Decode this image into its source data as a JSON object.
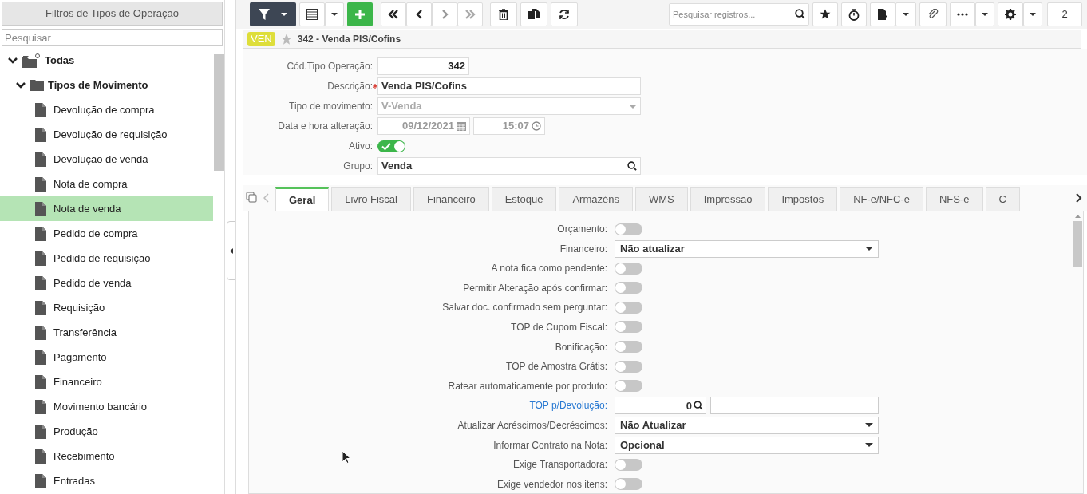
{
  "sidebar": {
    "title": "Filtros de Tipos de Operação",
    "search": {
      "placeholder": "Pesquisar"
    },
    "tree": [
      {
        "label": "Todas",
        "kind": "root",
        "expanded": true,
        "children": [
          {
            "label": "Tipos de Movimento",
            "kind": "folder",
            "expanded": true,
            "children": [
              {
                "label": "Devolução de compra",
                "selected": false
              },
              {
                "label": "Devolução de requisição",
                "selected": false
              },
              {
                "label": "Devolução de venda",
                "selected": false
              },
              {
                "label": "Nota de compra",
                "selected": false
              },
              {
                "label": "Nota de venda",
                "selected": true
              },
              {
                "label": "Pedido de compra",
                "selected": false
              },
              {
                "label": "Pedido de requisição",
                "selected": false
              },
              {
                "label": "Pedido de venda",
                "selected": false
              },
              {
                "label": "Requisição",
                "selected": false
              },
              {
                "label": "Transferência",
                "selected": false
              },
              {
                "label": "Pagamento",
                "selected": false
              },
              {
                "label": "Financeiro",
                "selected": false
              },
              {
                "label": "Movimento bancário",
                "selected": false
              },
              {
                "label": "Produção",
                "selected": false
              },
              {
                "label": "Recebimento",
                "selected": false
              },
              {
                "label": "Entradas",
                "selected": false
              }
            ]
          }
        ]
      }
    ]
  },
  "toolbar": {
    "search": {
      "placeholder": "Pesquisar registros..."
    },
    "counter": "2"
  },
  "record": {
    "badge": "VEN",
    "title": "342 - Venda PIS/Cofins"
  },
  "header_fields": [
    {
      "kind": "text",
      "label": "Cód.Tipo Operação:",
      "value": "342"
    },
    {
      "kind": "text",
      "label": "Descrição:",
      "value": "Venda PIS/Cofins",
      "required": true
    },
    {
      "kind": "select",
      "label": "Tipo de movimento:",
      "value": "V-Venda",
      "disabled": true
    },
    {
      "kind": "datetime",
      "label": "Data e hora alteração:",
      "date": "09/12/2021",
      "time": "15:07"
    },
    {
      "kind": "toggle",
      "label": "Ativo:",
      "on": true
    },
    {
      "kind": "lookup",
      "label": "Grupo:",
      "value": "Venda"
    }
  ],
  "tabs": [
    {
      "label": "Geral",
      "selected": true
    },
    {
      "label": "Livro Fiscal",
      "selected": false
    },
    {
      "label": "Financeiro",
      "selected": false
    },
    {
      "label": "Estoque",
      "selected": false
    },
    {
      "label": "Armazéns",
      "selected": false
    },
    {
      "label": "WMS",
      "selected": false
    },
    {
      "label": "Impressão",
      "selected": false
    },
    {
      "label": "Impostos",
      "selected": false
    },
    {
      "label": "NF-e/NFC-e",
      "selected": false
    },
    {
      "label": "NFS-e",
      "selected": false
    },
    {
      "label": "C",
      "selected": false
    }
  ],
  "settings": [
    {
      "kind": "toggle",
      "label": "Orçamento:",
      "on": false
    },
    {
      "kind": "select",
      "label": "Financeiro:",
      "value": "Não atualizar"
    },
    {
      "kind": "toggle",
      "label": "A nota fica como pendente:",
      "on": false
    },
    {
      "kind": "toggle",
      "label": "Permitir Alteração após confirmar:",
      "on": false
    },
    {
      "kind": "toggle",
      "label": "Salvar doc. confirmado sem perguntar:",
      "on": false
    },
    {
      "kind": "toggle",
      "label": "TOP de Cupom Fiscal:",
      "on": false
    },
    {
      "kind": "toggle",
      "label": "Bonificação:",
      "on": false
    },
    {
      "kind": "toggle",
      "label": "TOP de Amostra Grátis:",
      "on": false
    },
    {
      "kind": "toggle",
      "label": "Ratear automaticamente por produto:",
      "on": false
    },
    {
      "kind": "lookup",
      "label": "TOP p/Devolução:",
      "value": "0"
    },
    {
      "kind": "select",
      "label": "Atualizar Acréscimos/Decréscimos:",
      "value": "Não Atualizar"
    },
    {
      "kind": "select",
      "label": "Informar Contrato na Nota:",
      "value": "Opcional"
    },
    {
      "kind": "toggle",
      "label": "Exige Transportadora:",
      "on": false
    },
    {
      "kind": "toggle",
      "label": "Exige vendedor nos itens:",
      "on": false
    }
  ]
}
